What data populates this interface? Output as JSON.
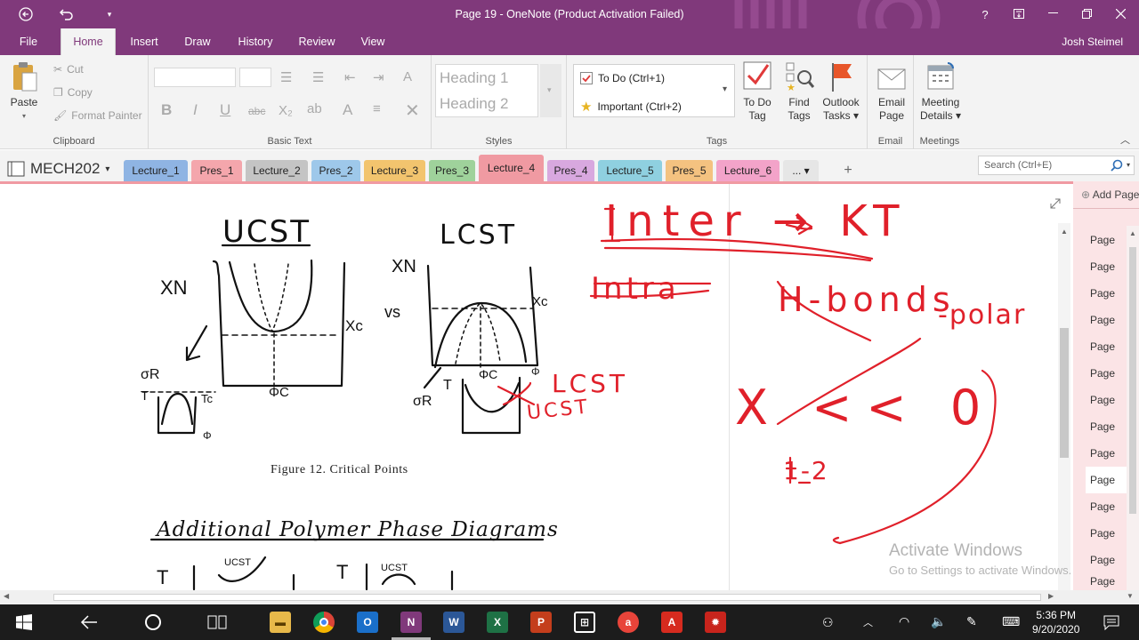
{
  "window": {
    "title": "Page 19 - OneNote (Product Activation Failed)",
    "help": "?",
    "back_icon": "back-arrow-icon",
    "undo_icon": "undo-icon"
  },
  "menu": {
    "tabs": [
      "File",
      "Home",
      "Insert",
      "Draw",
      "History",
      "Review",
      "View"
    ],
    "active": "Home",
    "user": "Josh Steimel"
  },
  "ribbon": {
    "clipboard": {
      "paste": "Paste",
      "cut": "Cut",
      "copy": "Copy",
      "format_painter": "Format Painter",
      "label": "Clipboard"
    },
    "basic_text": {
      "label": "Basic Text",
      "bold": "B",
      "italic": "I",
      "underline": "U",
      "strike": "abc",
      "subscript": "X₂",
      "font_color": "A"
    },
    "styles": {
      "heading1": "Heading 1",
      "heading2": "Heading 2",
      "label": "Styles"
    },
    "tags": {
      "todo": "To Do (Ctrl+1)",
      "important": "Important (Ctrl+2)",
      "label": "Tags",
      "todo_tag_1": "To Do",
      "todo_tag_2": "Tag",
      "find_1": "Find",
      "find_2": "Tags",
      "outlook_1": "Outlook",
      "outlook_2": "Tasks ▾"
    },
    "email": {
      "line1": "Email",
      "line2": "Page",
      "label": "Email"
    },
    "meetings": {
      "line1": "Meeting",
      "line2": "Details ▾",
      "label": "Meetings"
    }
  },
  "notebook": {
    "name": "MECH202"
  },
  "sections": [
    "Lecture_1",
    "Pres_1",
    "Lecture_2",
    "Pres_2",
    "Lecture_3",
    "Pres_3",
    "Lecture_4",
    "Pres_4",
    "Lecture_5",
    "Pres_5",
    "Lecture_6",
    "..."
  ],
  "active_section": "Lecture_4",
  "search": {
    "placeholder": "Search (Ctrl+E)"
  },
  "pages_panel": {
    "add_page": "Add Page",
    "page_label": "Page"
  },
  "content": {
    "ucst": "UCST",
    "lcst": "LCST",
    "xn1": "XN",
    "xn2": "XN",
    "vs": "vs",
    "xc1": "Xc",
    "xc2": "Xc",
    "phic1": "ΦC",
    "phic2": "ΦC",
    "phi1": "Φ",
    "phi2": "Φ",
    "or1": "σR",
    "or2": "σR",
    "t1": "T",
    "t2": "T",
    "t3": "T",
    "t4": "T",
    "tc": "Tc",
    "caption": "Figure 12. Critical Points",
    "lcst_red": "LCST",
    "ucst_red": "UCST",
    "heading2": "Additional Polymer Phase Diagrams",
    "small_ucst": "UCST",
    "small_ucst2": "UCST",
    "inter": "Inter → KT",
    "intra": "Intra",
    "hbonds": "H-bonds",
    "polar": "-polar",
    "x_rel": "X << 0",
    "one_two": "1-2"
  },
  "activation": {
    "line1": "Activate Windows",
    "line2": "Go to Settings to activate Windows."
  },
  "taskbar": {
    "time": "5:36 PM",
    "date": "9/20/2020"
  },
  "colors": {
    "purple": "#80397b",
    "ink_red": "#e0202a",
    "page_tab": "#f09aa2"
  }
}
